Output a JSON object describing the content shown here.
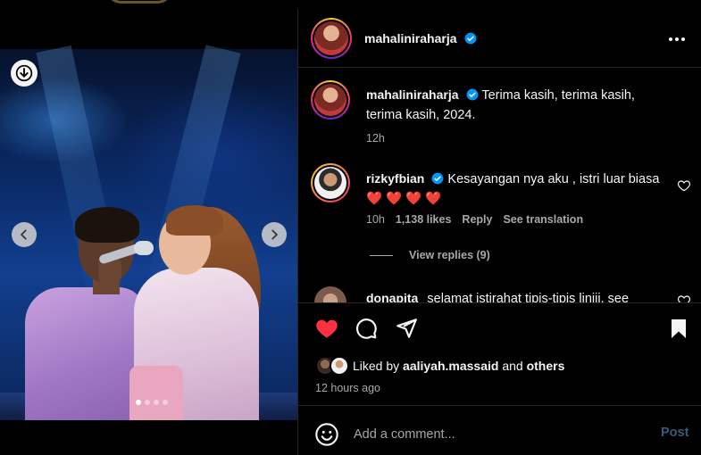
{
  "post": {
    "author": "mahaliniraharja",
    "media": {
      "slides_total": 4,
      "active_slide": 1
    }
  },
  "caption": {
    "username": "mahaliniraharja",
    "text": "Terima kasih, terima kasih, terima kasih, 2024.",
    "time": "12h"
  },
  "comments": [
    {
      "username": "rizkyfbian",
      "text": "Kesayangan nya aku , istri luar biasa ❤️ ❤️ ❤️ ❤️",
      "time": "10h",
      "likes": "1,138 likes",
      "reply_label": "Reply",
      "translate_label": "See translation",
      "view_replies": "View replies (9)"
    },
    {
      "username": "donapita",
      "text": "selamat istirahat tipis-tipis liniii, see"
    }
  ],
  "footer": {
    "liked_prefix": "Liked by",
    "liked_user": "aaliyah.massaid",
    "liked_and": "and",
    "liked_others": "others",
    "time_ago": "12 hours ago",
    "comment_placeholder": "Add a comment...",
    "post_label": "Post"
  },
  "colors": {
    "like_red": "#ff3040",
    "verified_blue": "#0095f6",
    "muted": "#a8a8a8"
  },
  "icons": [
    "download-icon",
    "chevron-left-icon",
    "chevron-right-icon",
    "more-icon",
    "verified-icon",
    "heart-icon",
    "comment-icon",
    "share-icon",
    "bookmark-icon",
    "emoji-icon"
  ]
}
